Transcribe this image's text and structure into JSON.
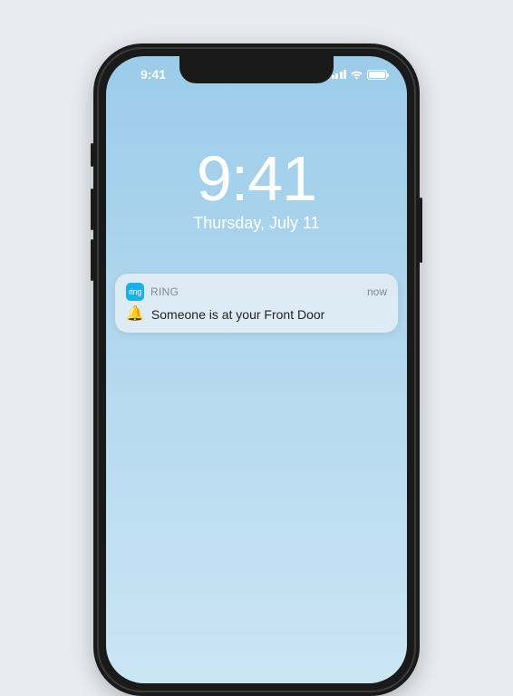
{
  "status_bar": {
    "time": "9:41"
  },
  "lock_screen": {
    "time": "9:41",
    "date": "Thursday, July 11"
  },
  "notification": {
    "app_icon_label": "ring",
    "app_name": "RING",
    "when": "now",
    "bell_glyph": "🔔",
    "message": "Someone is at your Front Door"
  }
}
